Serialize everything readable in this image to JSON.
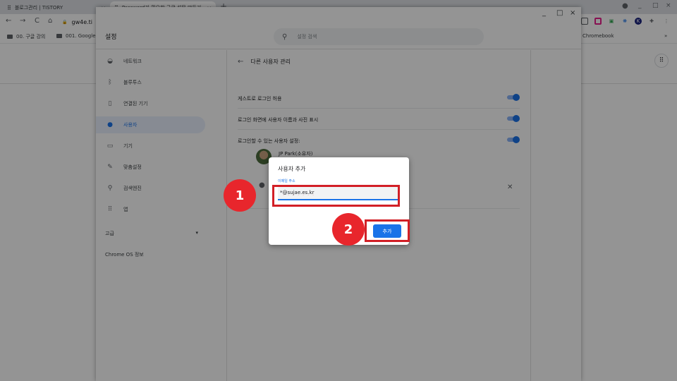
{
  "browser": {
    "tabs": [
      {
        "title": "블로그관리 | TISTORY",
        "icon": "tistory-icon",
        "close": "×"
      },
      {
        "title": "Password가 필요한 구글 설문 만들기",
        "icon": "tistory-icon",
        "close": "×"
      }
    ],
    "new_tab": "+",
    "window_controls": [
      "_",
      "□",
      "×"
    ],
    "url": "gw4e.ti",
    "nav": {
      "back": "←",
      "forward": "→",
      "reload": "C",
      "home": "⌂"
    },
    "bookmarks": [
      "00. 구글 강의",
      "001. Google",
      "Chromebook"
    ],
    "bookmarks_more": "»"
  },
  "settings": {
    "title": "설정",
    "search_placeholder": "설정 검색",
    "window_controls": [
      "_",
      "□",
      "×"
    ],
    "sidebar": {
      "items": [
        {
          "label": "네트워크",
          "icon": "wifi-icon"
        },
        {
          "label": "블루투스",
          "icon": "bluetooth-icon"
        },
        {
          "label": "연결된 기기",
          "icon": "phone-icon"
        },
        {
          "label": "사용자",
          "icon": "person-icon"
        },
        {
          "label": "기기",
          "icon": "laptop-icon"
        },
        {
          "label": "맞춤설정",
          "icon": "brush-icon"
        },
        {
          "label": "검색엔진",
          "icon": "search-icon"
        },
        {
          "label": "앱",
          "icon": "apps-grid-icon"
        }
      ],
      "selected_index": 3,
      "advanced": "고급",
      "about": "Chrome OS 정보"
    },
    "page_title": "다른 사용자 관리",
    "rows": [
      {
        "label": "게스트로 로그인 허용",
        "enabled": true
      },
      {
        "label": "로그인 화면에 사용자 이름과 사진 표시",
        "enabled": true
      },
      {
        "label": "로그인할 수 있는 사용자 설정:",
        "enabled": true
      }
    ],
    "user_name": "JP Park(소유자)"
  },
  "dialog": {
    "title": "사용자 추가",
    "field_label": "이메일 주소",
    "email_value": "*@sujae.es.kr",
    "add_button": "추가"
  },
  "annotations": {
    "step1": "1",
    "step2": "2"
  },
  "colors": {
    "accent": "#1a73e8",
    "annotation_red": "#e8262c"
  }
}
